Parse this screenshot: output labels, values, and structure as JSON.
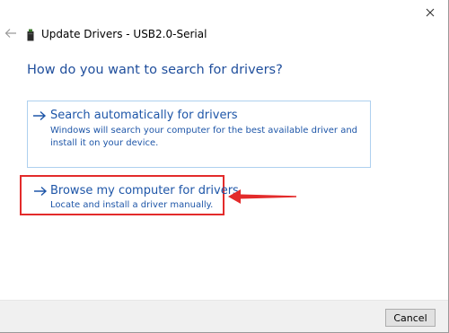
{
  "window": {
    "title": "Update Drivers - USB2.0-Serial",
    "close_icon": "close-icon",
    "back_icon": "back-arrow-icon",
    "device_icon": "usb-device-icon"
  },
  "heading": "How do you want to search for drivers?",
  "options": [
    {
      "title": "Search automatically for drivers",
      "description": "Windows will search your computer for the best available driver and install it on your device.",
      "icon": "right-arrow-icon"
    },
    {
      "title": "Browse my computer for drivers",
      "description": "Locate and install a driver manually.",
      "icon": "right-arrow-icon",
      "highlighted": true
    }
  ],
  "annotation": {
    "icon": "red-arrow-annotation",
    "color": "#e32b2b"
  },
  "footer": {
    "cancel_label": "Cancel"
  },
  "colors": {
    "heading": "#1f4e9c",
    "link": "#1e56a8",
    "option_border": "#aed0ef",
    "highlight": "#e32b2b"
  }
}
